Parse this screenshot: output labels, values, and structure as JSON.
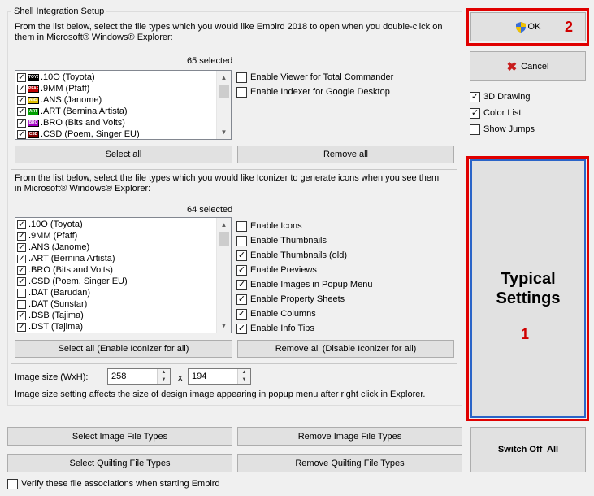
{
  "shell_group": {
    "title": "Shell Integration Setup",
    "embird_description_line1": "From the list below, select the file types which you would like Embird 2018 to open when you double-click on",
    "embird_description_line2": "them in Microsoft® Windows® Explorer:",
    "embird_selected_count": "65 selected",
    "embird_list": [
      {
        "label": ".10O (Toyota)",
        "checked": true,
        "icon_text": "TOYO",
        "icon_color": "#000000"
      },
      {
        "label": ".9MM (Pfaff)",
        "checked": true,
        "icon_text": "PFAFF",
        "icon_color": "#c00000"
      },
      {
        "label": ".ANS (Janome)",
        "checked": true,
        "icon_text": "ANS",
        "icon_color": "#e0c000"
      },
      {
        "label": ".ART (Bernina Artista)",
        "checked": true,
        "icon_text": "ART",
        "icon_color": "#00a000"
      },
      {
        "label": ".BRO (Bits and Volts)",
        "checked": true,
        "icon_text": "BRO",
        "icon_color": "#a000c0"
      },
      {
        "label": ".CSD (Poem, Singer EU)",
        "checked": true,
        "icon_text": "CSD",
        "icon_color": "#800000"
      }
    ],
    "enable_viewer_total_commander": {
      "label": "Enable Viewer for Total Commander",
      "checked": false
    },
    "enable_indexer_google_desktop": {
      "label": "Enable Indexer for Google Desktop",
      "checked": false
    },
    "select_all_label": "Select all",
    "remove_all_label": "Remove all",
    "iconizer_description_line1": "From the list below, select the file types which you would like Iconizer to generate icons when you see them",
    "iconizer_description_line2": "in Microsoft® Windows® Explorer:",
    "iconizer_selected_count": "64 selected",
    "iconizer_list": [
      {
        "label": ".10O (Toyota)",
        "checked": true
      },
      {
        "label": ".9MM (Pfaff)",
        "checked": true
      },
      {
        "label": ".ANS (Janome)",
        "checked": true
      },
      {
        "label": ".ART (Bernina Artista)",
        "checked": true
      },
      {
        "label": ".BRO (Bits and Volts)",
        "checked": true
      },
      {
        "label": ".CSD (Poem, Singer EU)",
        "checked": true
      },
      {
        "label": ".DAT (Barudan)",
        "checked": false
      },
      {
        "label": ".DAT (Sunstar)",
        "checked": false
      },
      {
        "label": ".DSB (Tajima)",
        "checked": true
      },
      {
        "label": ".DST (Tajima)",
        "checked": true
      }
    ],
    "iconizer_options": [
      {
        "label": "Enable Icons",
        "checked": false
      },
      {
        "label": "Enable Thumbnails",
        "checked": false
      },
      {
        "label": "Enable Thumbnails (old)",
        "checked": true
      },
      {
        "label": "Enable Previews",
        "checked": true
      },
      {
        "label": "Enable Images in Popup Menu",
        "checked": true
      },
      {
        "label": "Enable Property Sheets",
        "checked": true
      },
      {
        "label": "Enable Columns",
        "checked": true
      },
      {
        "label": "Enable Info Tips",
        "checked": true
      }
    ],
    "select_all_iconizer_label": "Select all (Enable Iconizer for all)",
    "remove_all_iconizer_label": "Remove all (Disable Iconizer for all)",
    "image_size_label": "Image size (WxH):",
    "image_width": "258",
    "image_height": "194",
    "size_separator": "x",
    "image_size_note": "Image size setting affects the size of design image appearing in popup menu after right click in Explorer."
  },
  "bottom_buttons": {
    "select_image_file_types": "Select Image File Types",
    "remove_image_file_types": "Remove Image File Types",
    "select_quilting_file_types": "Select Quilting File Types",
    "remove_quilting_file_types": "Remove Quilting File Types",
    "switch_off_all": "Switch Off  All"
  },
  "verify_associations": {
    "label": "Verify these file associations when starting Embird",
    "checked": false
  },
  "right_panel": {
    "ok_label": "OK",
    "cancel_label": "Cancel",
    "drawing_3d": {
      "label": "3D Drawing",
      "checked": true
    },
    "color_list": {
      "label": "Color List",
      "checked": true
    },
    "show_jumps": {
      "label": "Show Jumps",
      "checked": false
    },
    "typical_settings_line1": "Typical",
    "typical_settings_line2": "Settings"
  },
  "annotations": {
    "marker_1": "1",
    "marker_2": "2",
    "highlight_color": "#e00000"
  }
}
